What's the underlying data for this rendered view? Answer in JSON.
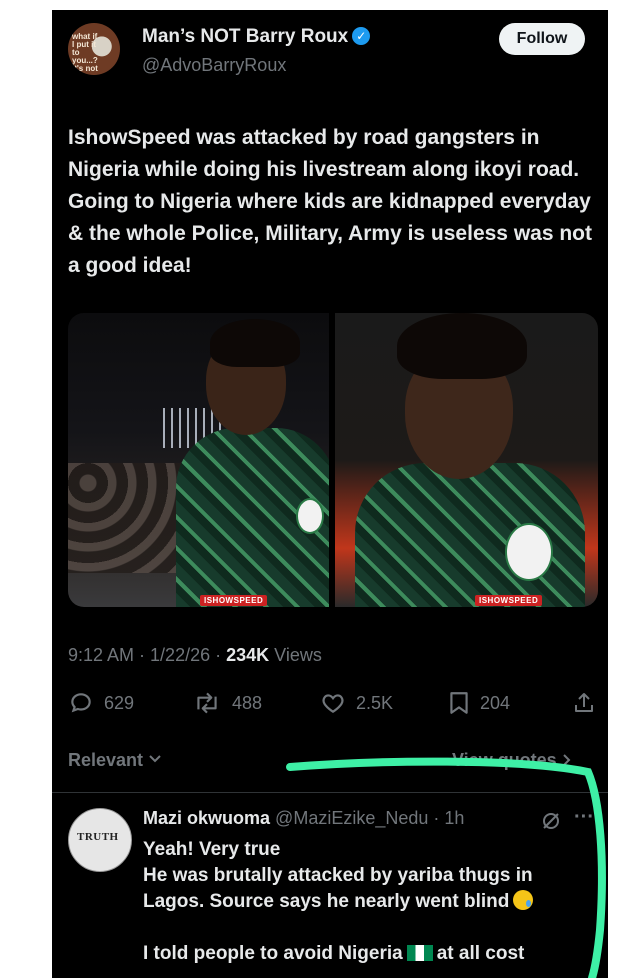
{
  "tweet": {
    "display_name": "Man’s NOT Barry Roux",
    "handle": "@AdvoBarryRoux",
    "follow_label": "Follow",
    "avatar_text": "what if I put it to you...? It's not",
    "text": "IshowSpeed was attacked by road gangsters in Nigeria while doing his livestream along ikoyi road. Going to Nigeria where kids are kidnapped everyday & the whole Police, Military, Army is useless was not a good idea!",
    "media_watermark": "ISHOWSPEED",
    "time": "9:12 AM",
    "date": "1/22/26",
    "views_count": "234K",
    "views_label": "Views",
    "stats": {
      "replies": "629",
      "reposts": "488",
      "likes": "2.5K",
      "bookmarks": "204"
    }
  },
  "replies_header": {
    "sort_label": "Relevant",
    "view_quotes_label": "View quotes"
  },
  "reply": {
    "display_name": "Mazi okwuoma",
    "handle": "@MaziEzike_Nedu",
    "time": "1h",
    "avatar_text": "TRUTH",
    "line1": "Yeah! Very true",
    "line2": "He was brutally attacked by yariba thugs in Lagos. Source says he nearly went blind",
    "line3_pre": "I told people to avoid Nigeria",
    "line3_post": "at all cost"
  },
  "colors": {
    "background": "#000000",
    "text_primary": "#e7e9ea",
    "text_secondary": "#71767b",
    "verified": "#1d9bf0",
    "annotation": "#3ef0a6"
  },
  "icons": [
    "verified-badge-icon",
    "reply-icon",
    "repost-icon",
    "like-icon",
    "bookmark-icon",
    "share-icon",
    "chevron-down-icon",
    "chevron-right-icon",
    "grok-icon",
    "more-icon",
    "nigeria-flag-icon",
    "crying-face-icon"
  ]
}
